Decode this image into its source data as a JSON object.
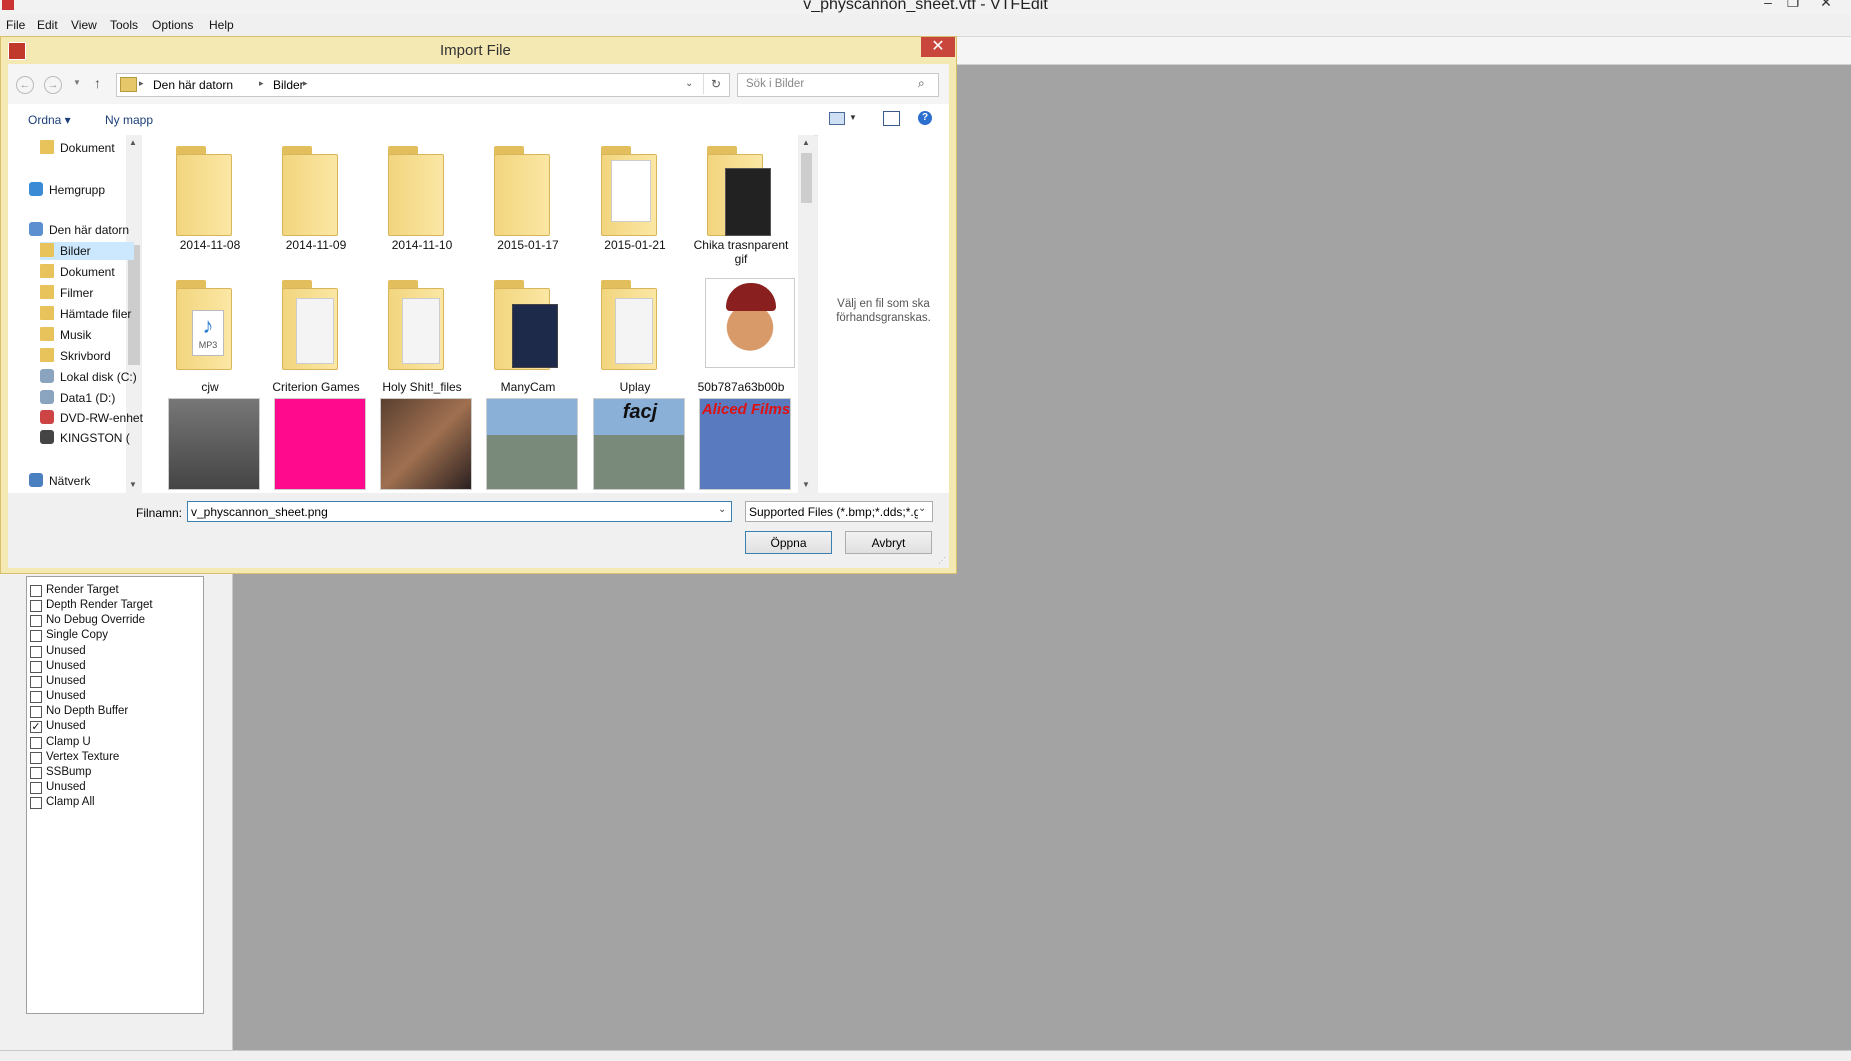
{
  "window": {
    "title": "v_physcannon_sheet.vtf - VTFEdit"
  },
  "menu": [
    "File",
    "Edit",
    "View",
    "Tools",
    "Options",
    "Help"
  ],
  "dialog": {
    "title": "Import File",
    "close_glyph": "✕",
    "address": {
      "segments": [
        "Den här datorn",
        "Bilder"
      ],
      "separator": "▸"
    },
    "search_placeholder": "Sök i Bilder",
    "commands": {
      "organize": "Ordna ▾",
      "new_folder": "Ny mapp"
    },
    "nav_items": [
      {
        "label": "Dokument",
        "icon": "folder-icon"
      },
      {
        "label": "Hemgrupp",
        "icon": "homegroup-icon"
      },
      {
        "label": "Den här datorn",
        "icon": "computer-icon"
      },
      {
        "label": "Bilder",
        "icon": "folder-icon"
      },
      {
        "label": "Dokument",
        "icon": "folder-icon"
      },
      {
        "label": "Filmer",
        "icon": "folder-icon"
      },
      {
        "label": "Hämtade filer",
        "icon": "folder-icon"
      },
      {
        "label": "Musik",
        "icon": "folder-icon"
      },
      {
        "label": "Skrivbord",
        "icon": "folder-icon"
      },
      {
        "label": "Lokal disk (C:)",
        "icon": "disk-icon"
      },
      {
        "label": "Data1 (D:)",
        "icon": "disk-icon"
      },
      {
        "label": "DVD-RW-enhet",
        "icon": "dvd-icon"
      },
      {
        "label": "KINGSTON (",
        "icon": "usb-icon"
      },
      {
        "label": "Nätverk",
        "icon": "network-icon"
      }
    ],
    "files_row1": [
      "2014-11-08",
      "2014-11-09",
      "2014-11-10",
      "2015-01-17",
      "2015-01-21",
      "Chika trasnparent gif"
    ],
    "files_row2": [
      "cjw",
      "Criterion Games",
      "Holy Shit!_files",
      "ManyCam",
      "Uplay",
      "50b787a63b00b"
    ],
    "thumb_texts": {
      "facj": "facj",
      "aliced": "Aliced Films"
    },
    "preview_text": "Välj en fil som ska förhandsgranskas.",
    "filename_label": "Filnamn:",
    "filename_value": "v_physcannon_sheet.png",
    "filetype": "Supported Files (*.bmp;*.dds;*.g",
    "open_button": "Öppna",
    "cancel_button": "Avbryt"
  },
  "flags": [
    {
      "label": "Render Target",
      "checked": false
    },
    {
      "label": "Depth Render Target",
      "checked": false
    },
    {
      "label": "No Debug Override",
      "checked": false
    },
    {
      "label": "Single Copy",
      "checked": false
    },
    {
      "label": "Unused",
      "checked": false
    },
    {
      "label": "Unused",
      "checked": false
    },
    {
      "label": "Unused",
      "checked": false
    },
    {
      "label": "Unused",
      "checked": false
    },
    {
      "label": "No Depth Buffer",
      "checked": false
    },
    {
      "label": "Unused",
      "checked": true
    },
    {
      "label": "Clamp U",
      "checked": false
    },
    {
      "label": "Vertex Texture",
      "checked": false
    },
    {
      "label": "SSBump",
      "checked": false
    },
    {
      "label": "Unused",
      "checked": false
    },
    {
      "label": "Clamp All",
      "checked": false
    }
  ],
  "colors": {
    "dialog_frame": "#f5e9b3",
    "close_button": "#c9463d",
    "workspace": "#a3a3a3",
    "pink_thumb": "#ff0a8c"
  }
}
